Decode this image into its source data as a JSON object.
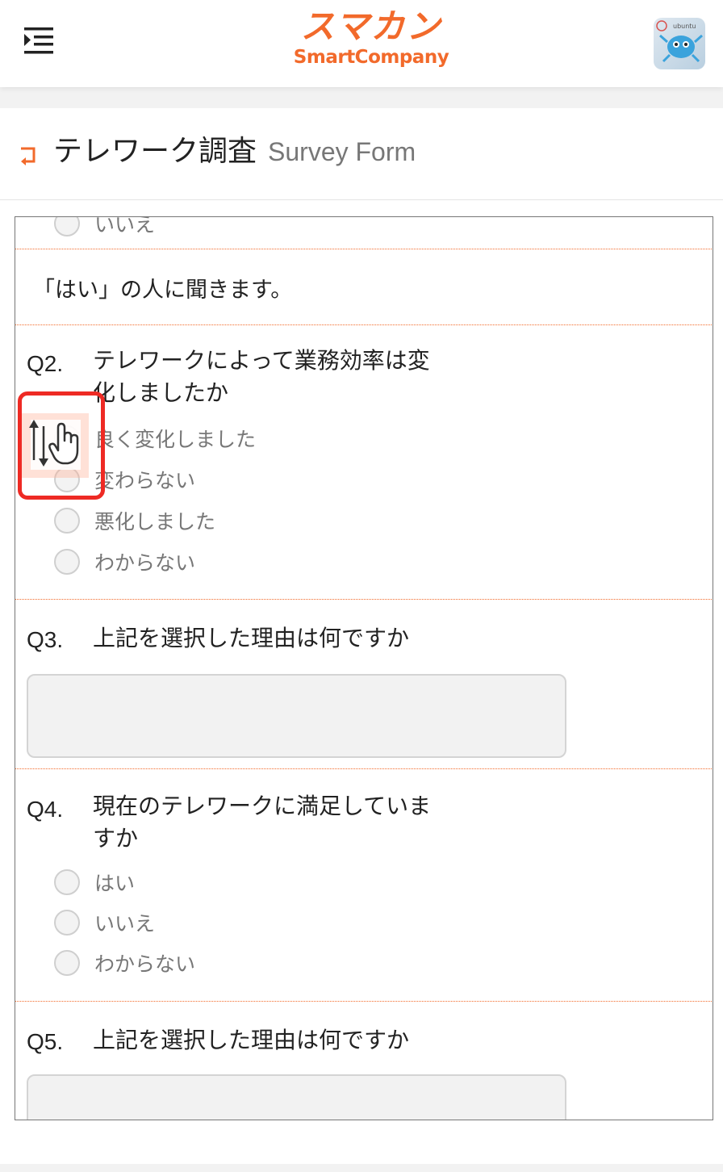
{
  "header": {
    "menu_icon": "menu-indent-icon",
    "logo_jp": "スマカン",
    "logo_en": "SmartCompany",
    "brand_color": "#f26a2b",
    "avatar_icon": "ubuntu-crab-avatar",
    "avatar_text": "ubuntu"
  },
  "page": {
    "back_icon": "return-arrow-icon",
    "title": "テレワーク調査",
    "subtitle": "Survey Form"
  },
  "form": {
    "partial_prev_option": "いいえ",
    "intro": "「はい」の人に聞きます。",
    "q2": {
      "no": "Q2.",
      "text": "テレワークによって業務効率は変化しましたか",
      "options": [
        "良く変化しました",
        "変わらない",
        "悪化しました",
        "わからない"
      ]
    },
    "q3": {
      "no": "Q3.",
      "text": "上記を選択した理由は何ですか",
      "value": ""
    },
    "q4": {
      "no": "Q4.",
      "text": "現在のテレワークに満足していますか",
      "options": [
        "はい",
        "いいえ",
        "わからない"
      ]
    },
    "q5": {
      "no": "Q5.",
      "text": "上記を選択した理由は何ですか",
      "value": ""
    }
  },
  "overlay": {
    "gesture_icon": "scroll-drag-hand-icon",
    "highlight_color": "#ee2a24"
  }
}
